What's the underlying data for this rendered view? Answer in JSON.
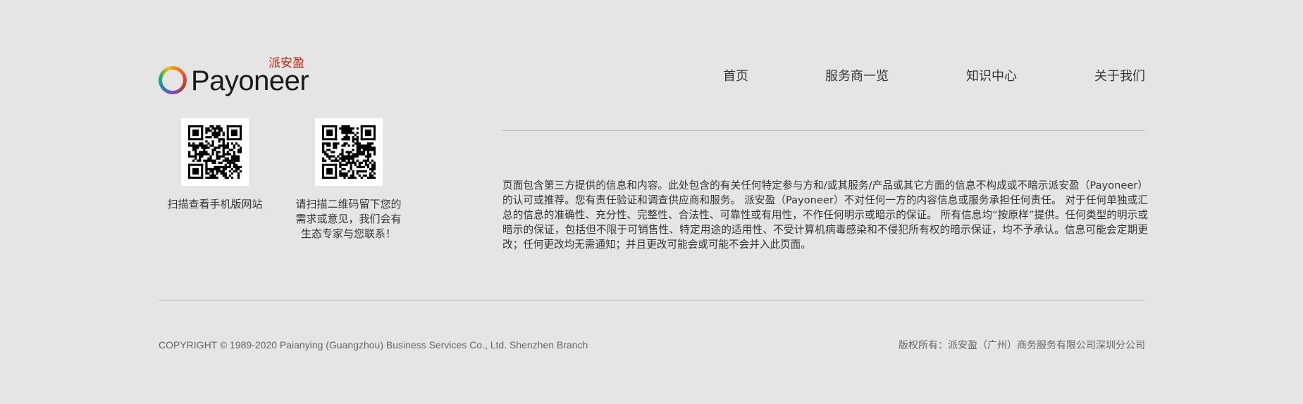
{
  "brand": {
    "name": "Payoneer",
    "cn_name": "派安盈",
    "accent_color": "#d4240f"
  },
  "nav": {
    "items": [
      {
        "label": "首页"
      },
      {
        "label": "服务商一览"
      },
      {
        "label": "知识中心"
      },
      {
        "label": "关于我们"
      }
    ]
  },
  "qr_codes": [
    {
      "icon": "qr-code-icon",
      "caption_lines": [
        "扫描查看手机版网站"
      ]
    },
    {
      "icon": "qr-code-icon",
      "caption_lines": [
        "请扫描二维码留下您的",
        "需求或意见，我们会有",
        "生态专家与您联系！"
      ]
    }
  ],
  "disclaimer": "页面包含第三方提供的信息和内容。此处包含的有关任何特定参与方和/或其服务/产品或其它方面的信息不构成或不暗示派安盈（Payoneer）的认可或推荐。您有责任验证和调查供应商和服务。 派安盈（Payoneer）不对任何一方的内容信息或服务承担任何责任。 对于任何单独或汇总的信息的准确性、充分性、完整性、合法性、可靠性或有用性，不作任何明示或暗示的保证。 所有信息均“按原样”提供。任何类型的明示或暗示的保证，包括但不限于可销售性、特定用途的适用性、不受计算机病毒感染和不侵犯所有权的暗示保证，均不予承认。信息可能会定期更改；任何更改均无需通知；并且更改可能会或可能不会并入此页面。",
  "copyright": "COPYRIGHT © 1989-2020 Paianying (Guangzhou) Business Services Co., Ltd. Shenzhen Branch",
  "rights": "版权所有：派安盈（广州）商务服务有限公司深圳分公司"
}
